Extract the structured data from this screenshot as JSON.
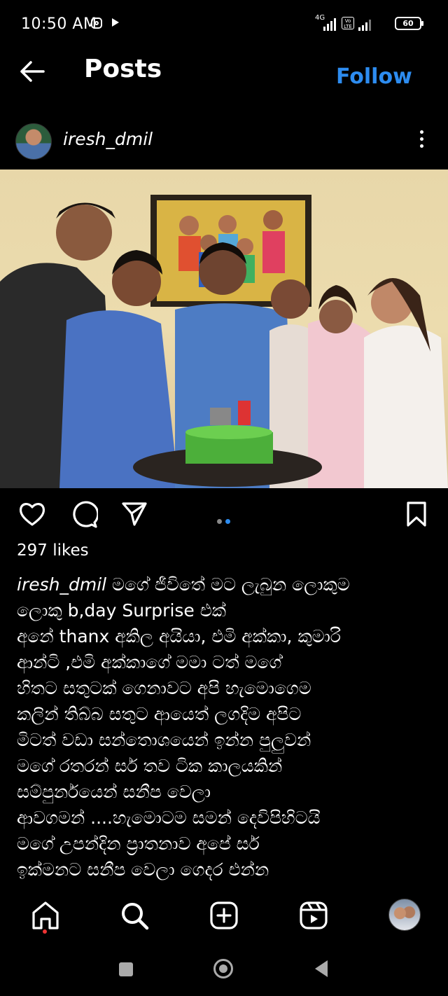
{
  "status_bar": {
    "time": "10:50 AM",
    "network": "4G",
    "volte": "Vo LTE",
    "battery": "60"
  },
  "header": {
    "title": "Posts",
    "follow_label": "Follow"
  },
  "post": {
    "username": "iresh_dmil",
    "likes": "297 likes",
    "caption_user": "iresh_dmil",
    "caption_lines": [
      " මගේ ජීවිතේ මට ලැබුන ලොකුම",
      "ලොකු b,day Surprise එක්",
      "අනේ thanx අකිල අයියා, එමි අක්කා, කුමාරි",
      "ආන්ටි ,එමි අක්කාගේ මමා  ටත් මගේ",
      "හිතට සතුටක් ගෙනාවට අපි හැමොගෙම",
      "කලින් තිබ්බ සතුට ආයෙත් ලගදිම අපිට",
      "මිටත් වඩා සන්තොශයෙන් ඉන්න පුලුවන්",
      "මගේ රතරන් සර් තව ටික කාලයකින්",
      "සම්පුර්නයෙන් සනීප වෙලා",
      "ආවගමන් ....හැමොටම සමන් දෙවිපිහිටයි",
      "මගේ උපන්දින ප්‍රාතනාව අපේ සර්",
      "ඉක්මනට සනීප වෙලා ගෙදර එන්න"
    ]
  },
  "icons": [
    "back-arrow-icon",
    "more-vertical-icon",
    "heart-icon",
    "comment-icon",
    "share-icon",
    "bookmark-icon",
    "home-icon",
    "search-icon",
    "create-icon",
    "reels-icon"
  ],
  "colors": {
    "background": "#000000",
    "follow": "#2d8cf0",
    "carousel_active": "#2d8cf0",
    "notification_dot": "#e33333"
  }
}
